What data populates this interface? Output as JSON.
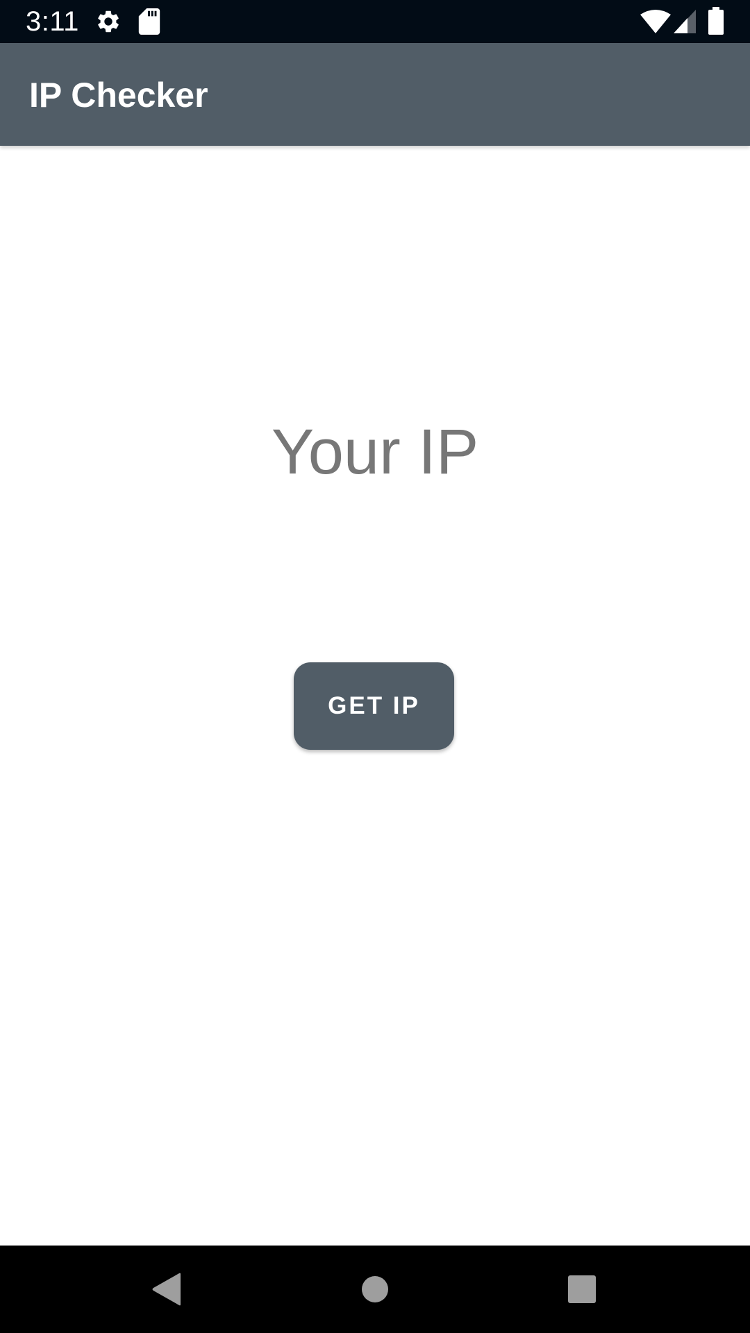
{
  "status_bar": {
    "time": "3:11",
    "icons": [
      "settings-icon",
      "sd-card-icon",
      "wifi-icon",
      "signal-icon",
      "battery-icon"
    ]
  },
  "app_bar": {
    "title": "IP Checker"
  },
  "main": {
    "ip_text": "Your IP",
    "get_ip_button": "GET IP"
  },
  "nav_bar": {
    "icons": [
      "back-icon",
      "home-icon",
      "recents-icon"
    ]
  },
  "colors": {
    "status_bar": "#020c16",
    "primary": "#515d67",
    "ip_text": "#777777",
    "background": "#ffffff",
    "nav_bar": "#000000",
    "nav_icons": "#9e9e9e"
  }
}
